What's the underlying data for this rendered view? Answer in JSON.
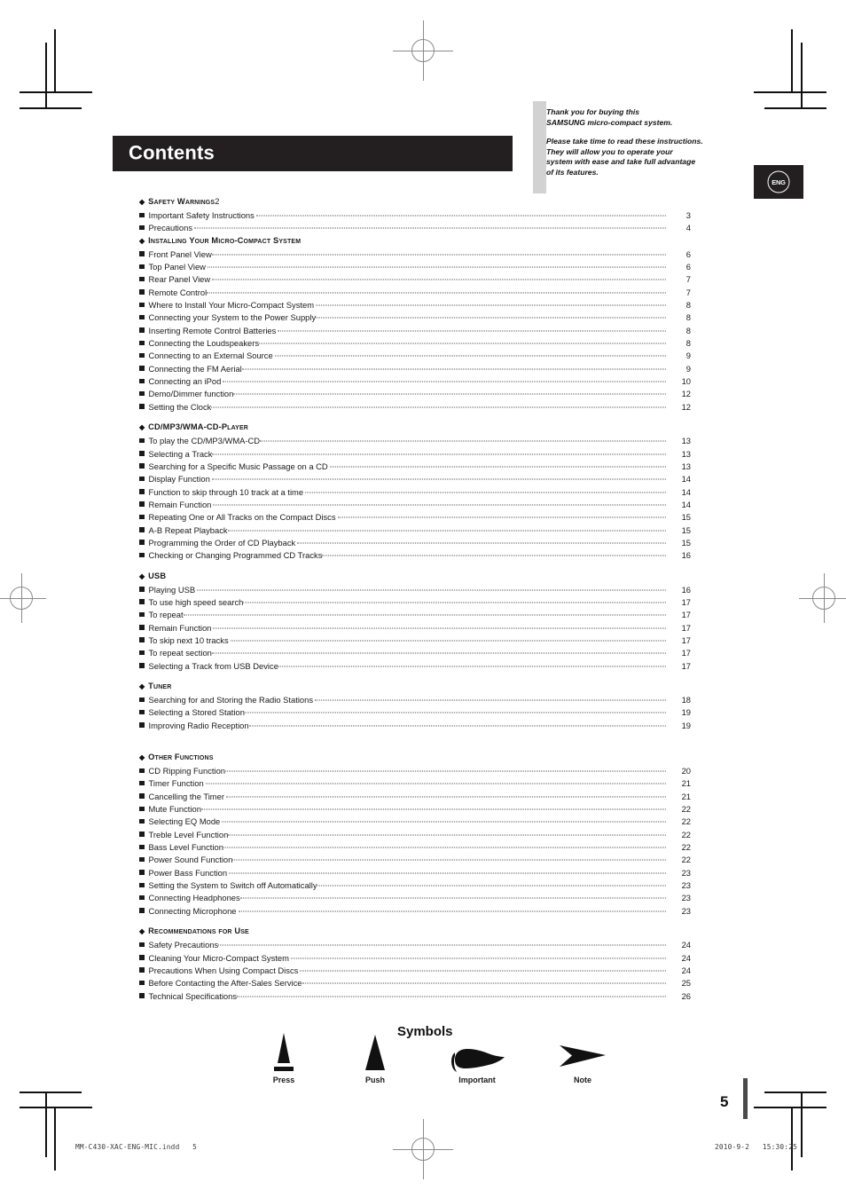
{
  "header": {
    "title": "Contents",
    "language_badge": "ENG",
    "intro": [
      "Thank you for buying this\nSAMSUNG micro-compact system.",
      "Please take time to read these instructions.\nThey will allow you to operate your\nsystem with ease and take full advantage\nof its features."
    ],
    "intro_line_1": "Thank you for buying this",
    "intro_line_2": "SAMSUNG micro-compact system.",
    "intro_line_3": "Please take time to read these instructions.",
    "intro_line_4": "They will allow you to operate your",
    "intro_line_5": "system with ease and take full advantage",
    "intro_line_6": "of its features."
  },
  "toc": {
    "sections": [
      {
        "heading": "Safety Warnings",
        "heading_page": "2",
        "heading_has_leader": true,
        "spacing": "none",
        "entries": [
          {
            "label": "Important Safety Instructions",
            "page": "3",
            "gap": true
          },
          {
            "label": "Precautions",
            "page": "4",
            "gap": true
          }
        ]
      },
      {
        "heading": "Installing Your Micro-Compact System",
        "heading_page": "",
        "heading_has_leader": false,
        "spacing": "none",
        "entries": [
          {
            "label": "Front Panel View",
            "page": "6",
            "gap": false
          },
          {
            "label": "Top Panel View",
            "page": "6",
            "gap": true
          },
          {
            "label": "Rear Panel View",
            "page": "7",
            "gap": true
          },
          {
            "label": "Remote Control",
            "page": "7",
            "gap": false
          },
          {
            "label": "Where to Install Your Micro-Compact System",
            "page": "8",
            "gap": true
          },
          {
            "label": "Connecting your System to the Power Supply",
            "page": "8",
            "gap": false
          },
          {
            "label": "Inserting Remote Control Batteries",
            "page": "8",
            "gap": true
          },
          {
            "label": "Connecting the Loudspeakers",
            "page": "8",
            "gap": false
          },
          {
            "label": "Connecting to an External Source",
            "page": "9",
            "gap": true
          },
          {
            "label": "Connecting the FM Aerial",
            "page": "9",
            "gap": false
          },
          {
            "label": "Connecting an iPod",
            "page": "10",
            "gap": true
          },
          {
            "label": "Demo/Dimmer function",
            "page": "12",
            "gap": false
          },
          {
            "label": "Setting the Clock",
            "page": "12",
            "gap": false
          }
        ]
      },
      {
        "heading": "CD/MP3/WMA-CD-Player",
        "heading_page": "",
        "heading_has_leader": false,
        "spacing": "pad",
        "entries": [
          {
            "label": "To play the CD/MP3/WMA-CD",
            "page": "13",
            "gap": false
          },
          {
            "label": "Selecting a Track",
            "page": "13",
            "gap": false
          },
          {
            "label": "Searching for a Specific Music Passage on a CD",
            "page": "13",
            "gap": true
          },
          {
            "label": "Display Function",
            "page": "14",
            "gap": true
          },
          {
            "label": "Function to skip through 10 track at a time",
            "page": "14",
            "gap": true
          },
          {
            "label": "Remain Function",
            "page": "14",
            "gap": true
          },
          {
            "label": "Repeating One or All Tracks on the Compact Discs",
            "page": "15",
            "gap": true
          },
          {
            "label": "A-B Repeat Playback",
            "page": "15",
            "gap": false
          },
          {
            "label": "Programming the Order of CD Playback",
            "page": "15",
            "gap": true
          },
          {
            "label": "Checking or Changing Programmed CD Tracks",
            "page": "16",
            "gap": false
          }
        ]
      },
      {
        "heading": "USB",
        "heading_page": "",
        "heading_has_leader": false,
        "spacing": "pad",
        "entries": [
          {
            "label": "Playing USB",
            "page": "16",
            "gap": true
          },
          {
            "label": "To use high speed search",
            "page": "17",
            "gap": false
          },
          {
            "label": "To repeat",
            "page": "17",
            "gap": false
          },
          {
            "label": "Remain Function",
            "page": "17",
            "gap": true
          },
          {
            "label": "To skip next 10 tracks",
            "page": "17",
            "gap": true
          },
          {
            "label": "To repeat section",
            "page": "17",
            "gap": false
          },
          {
            "label": "Selecting a Track from USB Device",
            "page": "17",
            "gap": false
          }
        ]
      },
      {
        "heading": "Tuner",
        "heading_page": "",
        "heading_has_leader": false,
        "spacing": "pad",
        "entries": [
          {
            "label": "Searching for and Storing the Radio Stations",
            "page": "18",
            "gap": true
          },
          {
            "label": "Selecting a Stored Station",
            "page": "19",
            "gap": false
          },
          {
            "label": " Improving Radio Reception",
            "page": "19",
            "gap": false
          }
        ]
      },
      {
        "heading": "Other Functions",
        "heading_page": "",
        "heading_has_leader": false,
        "spacing": "gap",
        "entries": [
          {
            "label": "CD Ripping Function",
            "page": "20",
            "gap": false
          },
          {
            "label": "Timer Function",
            "page": "21",
            "gap": true
          },
          {
            "label": "Cancelling the Timer",
            "page": "21",
            "gap": true
          },
          {
            "label": "Mute Function",
            "page": "22",
            "gap": false
          },
          {
            "label": "Selecting EQ  Mode",
            "page": "22",
            "gap": true
          },
          {
            "label": "Treble Level Function",
            "page": "22",
            "gap": false
          },
          {
            "label": "Bass Level Function",
            "page": "22",
            "gap": false
          },
          {
            "label": "Power Sound Function",
            "page": "22",
            "gap": false
          },
          {
            "label": "Power Bass Function",
            "page": "23",
            "gap": true
          },
          {
            "label": "Setting the System to Switch off Automatically",
            "page": "23",
            "gap": false
          },
          {
            "label": "Connecting Headphones",
            "page": "23",
            "gap": false
          },
          {
            "label": "Connecting Microphone",
            "page": "23",
            "gap": true
          }
        ]
      },
      {
        "heading": "Recommendations for Use",
        "heading_page": "",
        "heading_has_leader": false,
        "spacing": "pad",
        "entries": [
          {
            "label": "Safety Precautions",
            "page": "24",
            "gap": false
          },
          {
            "label": "Cleaning Your Micro-Compact System",
            "page": "24",
            "gap": true
          },
          {
            "label": "Precautions When Using Compact Discs",
            "page": "24",
            "gap": true
          },
          {
            "label": "Before Contacting the After-Sales Service",
            "page": "25",
            "gap": false
          },
          {
            "label": "Technical Specifications",
            "page": "26",
            "gap": false
          }
        ]
      }
    ]
  },
  "symbols": {
    "title": "Symbols",
    "items": [
      {
        "caption": "Press",
        "icon": "press-triangle-bar-icon"
      },
      {
        "caption": "Push",
        "icon": "push-triangle-icon"
      },
      {
        "caption": "Important",
        "icon": "pointing-hand-icon"
      },
      {
        "caption": "Note",
        "icon": "arrow-head-icon"
      }
    ]
  },
  "footer": {
    "page_number": "5",
    "file_name": "MM-C430-XAC-ENG-MIC.indd   5",
    "timestamp": "2010-9-2   15:30:25"
  }
}
